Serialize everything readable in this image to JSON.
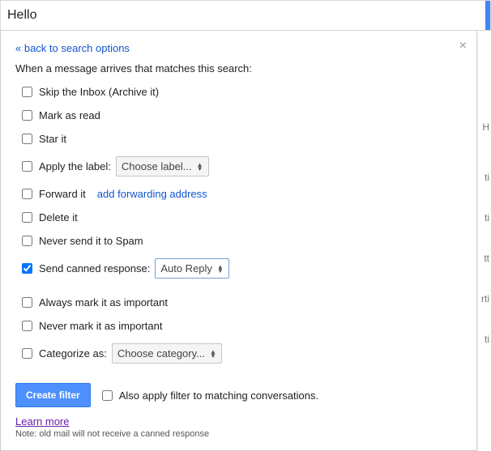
{
  "search": {
    "value": "Hello"
  },
  "back_link": "« back to search options",
  "intro": "When a message arrives that matches this search:",
  "options": {
    "skip_inbox": {
      "label": "Skip the Inbox (Archive it)",
      "checked": false
    },
    "mark_read": {
      "label": "Mark as read",
      "checked": false
    },
    "star": {
      "label": "Star it",
      "checked": false
    },
    "apply_label": {
      "label": "Apply the label:",
      "checked": false,
      "dropdown": "Choose label..."
    },
    "forward": {
      "label": "Forward it",
      "checked": false,
      "link": "add forwarding address"
    },
    "delete": {
      "label": "Delete it",
      "checked": false
    },
    "never_spam": {
      "label": "Never send it to Spam",
      "checked": false
    },
    "canned": {
      "label": "Send canned response:",
      "checked": true,
      "dropdown": "Auto Reply"
    },
    "always_important": {
      "label": "Always mark it as important",
      "checked": false
    },
    "never_important": {
      "label": "Never mark it as important",
      "checked": false
    },
    "categorize": {
      "label": "Categorize as:",
      "checked": false,
      "dropdown": "Choose category..."
    }
  },
  "create_button": "Create filter",
  "also_apply": {
    "label": "Also apply filter to matching conversations.",
    "checked": false
  },
  "learn_more": "Learn more",
  "note": "Note: old mail will not receive a canned response",
  "bg": {
    "h": "H",
    "ti1": "ti",
    "ti2": "ti",
    "tt": "tt",
    "rti": "rti",
    "ti3": "ti"
  }
}
